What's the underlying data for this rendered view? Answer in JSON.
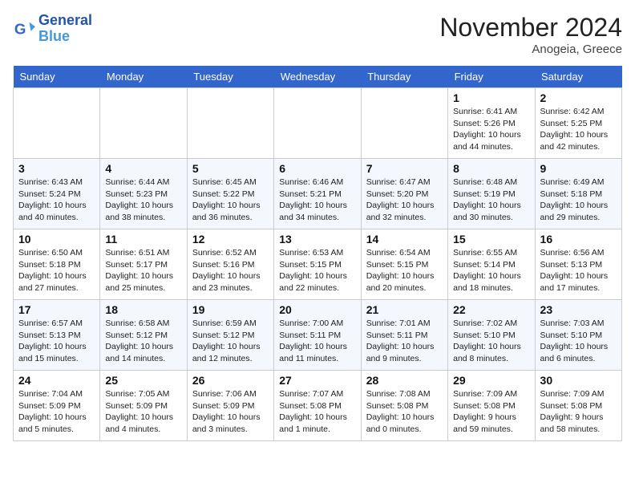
{
  "header": {
    "logo_line1": "General",
    "logo_line2": "Blue",
    "month": "November 2024",
    "location": "Anogeia, Greece"
  },
  "weekdays": [
    "Sunday",
    "Monday",
    "Tuesday",
    "Wednesday",
    "Thursday",
    "Friday",
    "Saturday"
  ],
  "weeks": [
    [
      {
        "num": "",
        "info": ""
      },
      {
        "num": "",
        "info": ""
      },
      {
        "num": "",
        "info": ""
      },
      {
        "num": "",
        "info": ""
      },
      {
        "num": "",
        "info": ""
      },
      {
        "num": "1",
        "info": "Sunrise: 6:41 AM\nSunset: 5:26 PM\nDaylight: 10 hours and 44 minutes."
      },
      {
        "num": "2",
        "info": "Sunrise: 6:42 AM\nSunset: 5:25 PM\nDaylight: 10 hours and 42 minutes."
      }
    ],
    [
      {
        "num": "3",
        "info": "Sunrise: 6:43 AM\nSunset: 5:24 PM\nDaylight: 10 hours and 40 minutes."
      },
      {
        "num": "4",
        "info": "Sunrise: 6:44 AM\nSunset: 5:23 PM\nDaylight: 10 hours and 38 minutes."
      },
      {
        "num": "5",
        "info": "Sunrise: 6:45 AM\nSunset: 5:22 PM\nDaylight: 10 hours and 36 minutes."
      },
      {
        "num": "6",
        "info": "Sunrise: 6:46 AM\nSunset: 5:21 PM\nDaylight: 10 hours and 34 minutes."
      },
      {
        "num": "7",
        "info": "Sunrise: 6:47 AM\nSunset: 5:20 PM\nDaylight: 10 hours and 32 minutes."
      },
      {
        "num": "8",
        "info": "Sunrise: 6:48 AM\nSunset: 5:19 PM\nDaylight: 10 hours and 30 minutes."
      },
      {
        "num": "9",
        "info": "Sunrise: 6:49 AM\nSunset: 5:18 PM\nDaylight: 10 hours and 29 minutes."
      }
    ],
    [
      {
        "num": "10",
        "info": "Sunrise: 6:50 AM\nSunset: 5:18 PM\nDaylight: 10 hours and 27 minutes."
      },
      {
        "num": "11",
        "info": "Sunrise: 6:51 AM\nSunset: 5:17 PM\nDaylight: 10 hours and 25 minutes."
      },
      {
        "num": "12",
        "info": "Sunrise: 6:52 AM\nSunset: 5:16 PM\nDaylight: 10 hours and 23 minutes."
      },
      {
        "num": "13",
        "info": "Sunrise: 6:53 AM\nSunset: 5:15 PM\nDaylight: 10 hours and 22 minutes."
      },
      {
        "num": "14",
        "info": "Sunrise: 6:54 AM\nSunset: 5:15 PM\nDaylight: 10 hours and 20 minutes."
      },
      {
        "num": "15",
        "info": "Sunrise: 6:55 AM\nSunset: 5:14 PM\nDaylight: 10 hours and 18 minutes."
      },
      {
        "num": "16",
        "info": "Sunrise: 6:56 AM\nSunset: 5:13 PM\nDaylight: 10 hours and 17 minutes."
      }
    ],
    [
      {
        "num": "17",
        "info": "Sunrise: 6:57 AM\nSunset: 5:13 PM\nDaylight: 10 hours and 15 minutes."
      },
      {
        "num": "18",
        "info": "Sunrise: 6:58 AM\nSunset: 5:12 PM\nDaylight: 10 hours and 14 minutes."
      },
      {
        "num": "19",
        "info": "Sunrise: 6:59 AM\nSunset: 5:12 PM\nDaylight: 10 hours and 12 minutes."
      },
      {
        "num": "20",
        "info": "Sunrise: 7:00 AM\nSunset: 5:11 PM\nDaylight: 10 hours and 11 minutes."
      },
      {
        "num": "21",
        "info": "Sunrise: 7:01 AM\nSunset: 5:11 PM\nDaylight: 10 hours and 9 minutes."
      },
      {
        "num": "22",
        "info": "Sunrise: 7:02 AM\nSunset: 5:10 PM\nDaylight: 10 hours and 8 minutes."
      },
      {
        "num": "23",
        "info": "Sunrise: 7:03 AM\nSunset: 5:10 PM\nDaylight: 10 hours and 6 minutes."
      }
    ],
    [
      {
        "num": "24",
        "info": "Sunrise: 7:04 AM\nSunset: 5:09 PM\nDaylight: 10 hours and 5 minutes."
      },
      {
        "num": "25",
        "info": "Sunrise: 7:05 AM\nSunset: 5:09 PM\nDaylight: 10 hours and 4 minutes."
      },
      {
        "num": "26",
        "info": "Sunrise: 7:06 AM\nSunset: 5:09 PM\nDaylight: 10 hours and 3 minutes."
      },
      {
        "num": "27",
        "info": "Sunrise: 7:07 AM\nSunset: 5:08 PM\nDaylight: 10 hours and 1 minute."
      },
      {
        "num": "28",
        "info": "Sunrise: 7:08 AM\nSunset: 5:08 PM\nDaylight: 10 hours and 0 minutes."
      },
      {
        "num": "29",
        "info": "Sunrise: 7:09 AM\nSunset: 5:08 PM\nDaylight: 9 hours and 59 minutes."
      },
      {
        "num": "30",
        "info": "Sunrise: 7:09 AM\nSunset: 5:08 PM\nDaylight: 9 hours and 58 minutes."
      }
    ]
  ]
}
